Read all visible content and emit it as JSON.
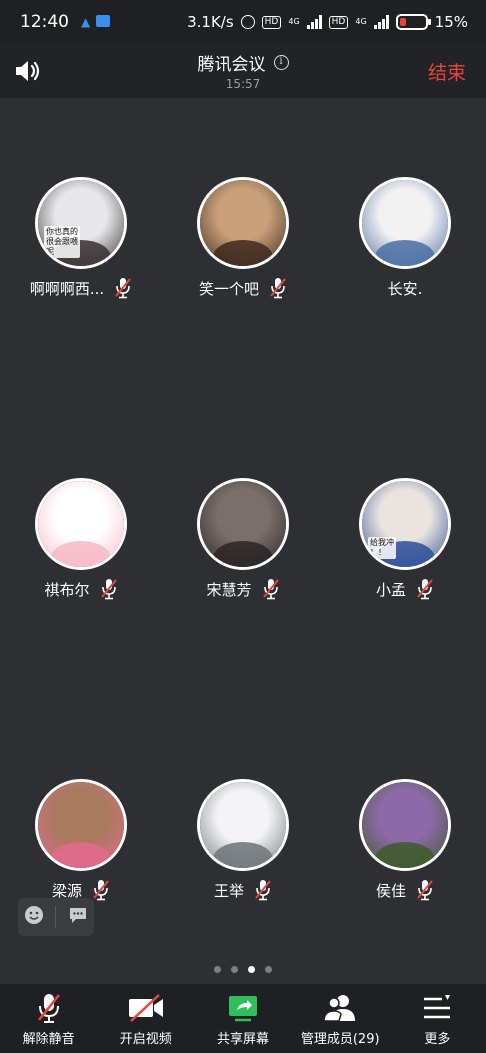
{
  "status_bar": {
    "time": "12:40",
    "network_speed": "3.1K/s",
    "battery": "15%"
  },
  "header": {
    "title": "腾讯会议",
    "duration": "15:57",
    "end_label": "结束"
  },
  "participants": [
    {
      "name": "啊啊啊西...",
      "muted": true,
      "avatar_colors": [
        "#e8e8ea",
        "#3a3030"
      ],
      "overlay": "你也真的\n很会跟喂\n呢"
    },
    {
      "name": "笑一个吧",
      "muted": true,
      "avatar_colors": [
        "#c9a07a",
        "#3d2a1e"
      ]
    },
    {
      "name": "长安.",
      "muted": false,
      "avatar_colors": [
        "#f2f2f2",
        "#4a6fa5"
      ]
    },
    {
      "name": "祺布尔",
      "muted": true,
      "avatar_colors": [
        "#ffffff",
        "#f7b9c5"
      ]
    },
    {
      "name": "宋慧芳",
      "muted": true,
      "avatar_colors": [
        "#7a6f6a",
        "#2a2626"
      ]
    },
    {
      "name": "小孟",
      "muted": true,
      "avatar_colors": [
        "#e9e4de",
        "#2e4f9a"
      ],
      "overlay": "给我冲\n！！"
    },
    {
      "name": "梁源",
      "muted": true,
      "avatar_colors": [
        "#a87a5e",
        "#e36a8d"
      ]
    },
    {
      "name": "王举",
      "muted": true,
      "avatar_colors": [
        "#f4f4f6",
        "#6f7479"
      ]
    },
    {
      "name": "侯佳",
      "muted": true,
      "avatar_colors": [
        "#8c6aa8",
        "#3e5a2a"
      ]
    }
  ],
  "pager": {
    "total": 4,
    "active": 2
  },
  "toolbar": {
    "unmute": "解除静音",
    "start_video": "开启视频",
    "share_screen": "共享屏幕",
    "manage_members": "管理成员(29)",
    "more": "更多"
  },
  "colors": {
    "accent_red": "#e8453c",
    "share_green": "#2fbf5b",
    "background": "#2d2f33"
  }
}
